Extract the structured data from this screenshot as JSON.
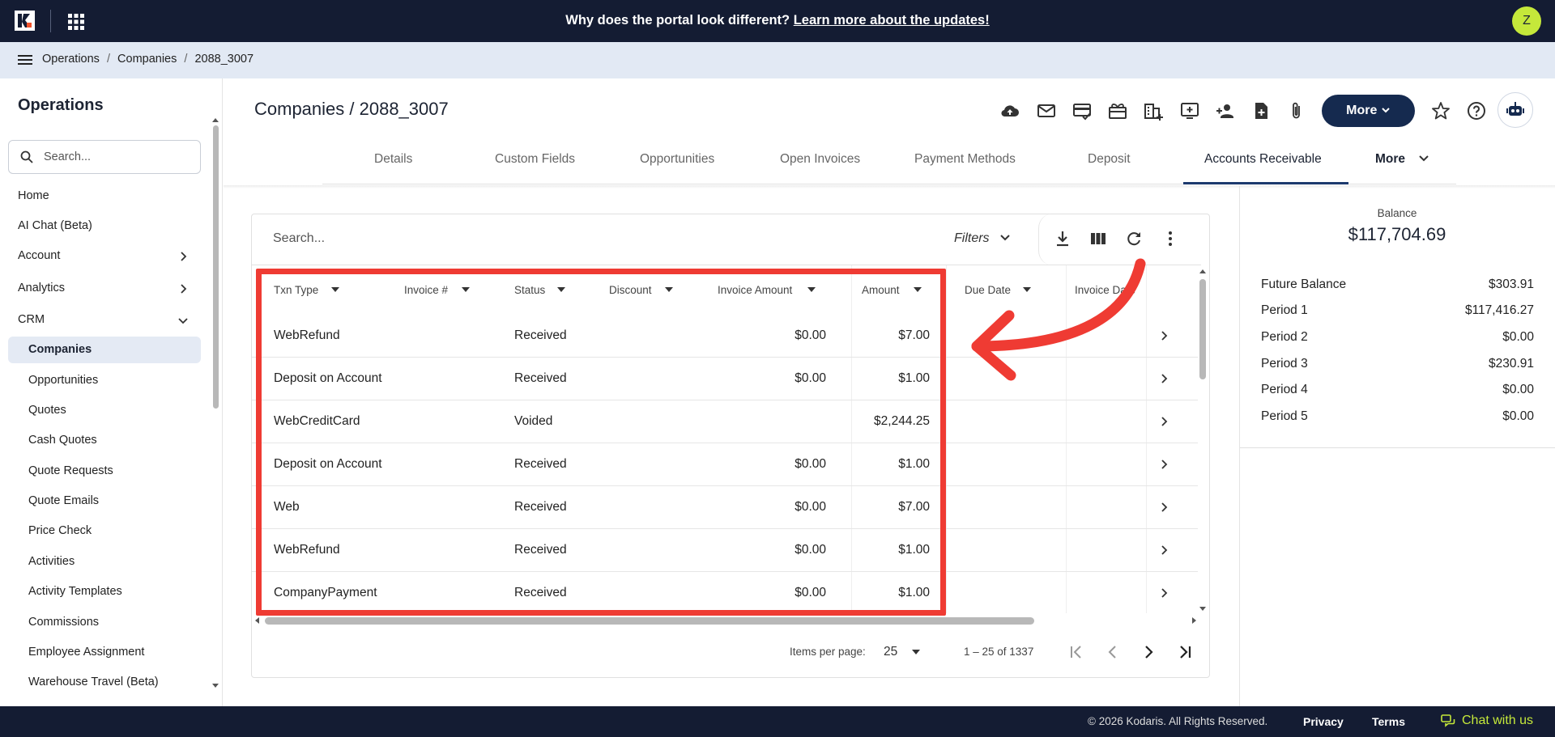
{
  "topbar": {
    "announcement": "Why does the portal look different?",
    "announcement_link": "Learn more about the updates!",
    "avatar_initial": "Z"
  },
  "breadcrumb": [
    "Operations",
    "/",
    "Companies",
    "/",
    "2088_3007"
  ],
  "sidebar": {
    "title": "Operations",
    "search_placeholder": "Search...",
    "items": [
      {
        "label": "Home"
      },
      {
        "label": "AI Chat (Beta)"
      },
      {
        "label": "Account"
      },
      {
        "label": "Analytics"
      },
      {
        "label": "CRM"
      }
    ],
    "crm_items": [
      {
        "label": "Companies"
      },
      {
        "label": "Opportunities"
      },
      {
        "label": "Quotes"
      },
      {
        "label": "Cash Quotes"
      },
      {
        "label": "Quote Requests"
      },
      {
        "label": "Quote Emails"
      },
      {
        "label": "Price Check"
      },
      {
        "label": "Activities"
      },
      {
        "label": "Activity Templates"
      },
      {
        "label": "Commissions"
      },
      {
        "label": "Employee Assignment"
      },
      {
        "label": "Warehouse Travel (Beta)"
      }
    ]
  },
  "header": {
    "title": "Companies / 2088_3007",
    "more_label": "More"
  },
  "tabs": [
    {
      "label": "Details"
    },
    {
      "label": "Custom Fields"
    },
    {
      "label": "Opportunities"
    },
    {
      "label": "Open Invoices"
    },
    {
      "label": "Payment Methods"
    },
    {
      "label": "Deposit"
    },
    {
      "label": "Accounts Receivable"
    },
    {
      "label": "More"
    }
  ],
  "grid": {
    "search_placeholder": "Search...",
    "filters_label": "Filters",
    "columns": [
      "Txn Type",
      "Invoice #",
      "Status",
      "Discount",
      "Invoice Amount",
      "Amount",
      "Due Date",
      "Invoice Date"
    ],
    "rows": [
      {
        "txn_type": "WebRefund",
        "status": "Received",
        "invoice_amount": "$0.00",
        "amount": "$7.00"
      },
      {
        "txn_type": "Deposit on Account",
        "status": "Received",
        "invoice_amount": "$0.00",
        "amount": "$1.00"
      },
      {
        "txn_type": "WebCreditCard",
        "status": "Voided",
        "invoice_amount": "",
        "amount": "$2,244.25"
      },
      {
        "txn_type": "Deposit on Account",
        "status": "Received",
        "invoice_amount": "$0.00",
        "amount": "$1.00"
      },
      {
        "txn_type": "Web",
        "status": "Received",
        "invoice_amount": "$0.00",
        "amount": "$7.00"
      },
      {
        "txn_type": "WebRefund",
        "status": "Received",
        "invoice_amount": "$0.00",
        "amount": "$1.00"
      },
      {
        "txn_type": "CompanyPayment",
        "status": "Received",
        "invoice_amount": "$0.00",
        "amount": "$1.00"
      }
    ],
    "pager": {
      "items_per_page_label": "Items per page:",
      "page_size": "25",
      "range": "1 – 25 of 1337"
    }
  },
  "balance": {
    "label": "Balance",
    "value": "$117,704.69",
    "periods": [
      {
        "label": "Future Balance",
        "value": "$303.91"
      },
      {
        "label": "Period 1",
        "value": "$117,416.27"
      },
      {
        "label": "Period 2",
        "value": "$0.00"
      },
      {
        "label": "Period 3",
        "value": "$230.91"
      },
      {
        "label": "Period 4",
        "value": "$0.00"
      },
      {
        "label": "Period 5",
        "value": "$0.00"
      }
    ]
  },
  "footer": {
    "copyright": "© 2026 Kodaris. All Rights Reserved.",
    "privacy": "Privacy",
    "terms": "Terms",
    "chat": "Chat with us"
  },
  "colors": {
    "topbar_bg": "#141c33",
    "accent_navy": "#152a4f",
    "avatar": "#c5e83a",
    "highlight_red": "#ef3b33"
  }
}
